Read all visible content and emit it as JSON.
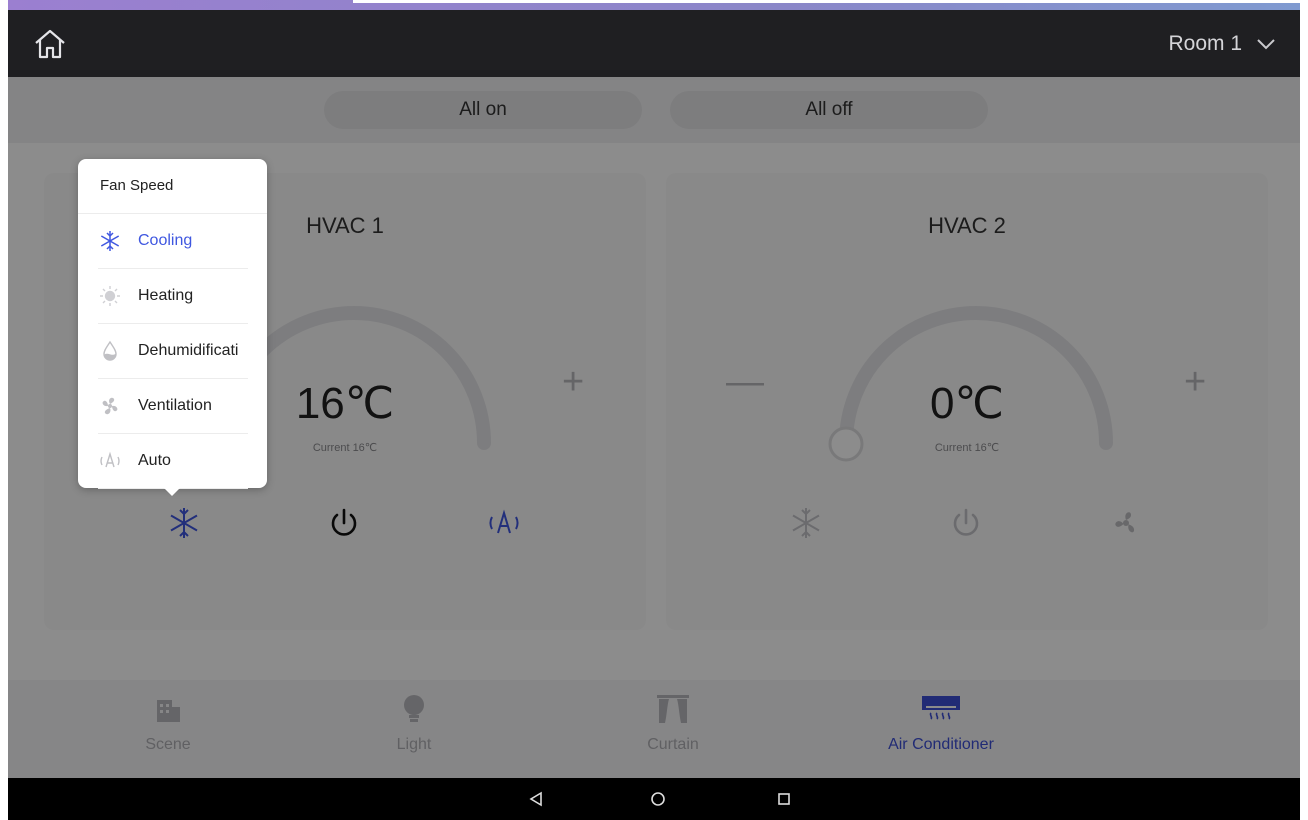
{
  "topbar": {
    "room_label": "Room 1"
  },
  "actions": {
    "all_on": "All on",
    "all_off": "All off"
  },
  "hvac": [
    {
      "name": "HVAC 1",
      "temperature": "16℃",
      "current": "Current 16℃"
    },
    {
      "name": "HVAC 2",
      "temperature": "0℃",
      "current": "Current 16℃"
    }
  ],
  "popup": {
    "title": "Fan Speed",
    "modes": [
      {
        "label": "Cooling",
        "icon": "snowflake-icon",
        "selected": true
      },
      {
        "label": "Heating",
        "icon": "sun-icon"
      },
      {
        "label": "Dehumidification",
        "icon": "droplet-icon"
      },
      {
        "label": "Ventilation",
        "icon": "fan-icon"
      },
      {
        "label": "Auto",
        "icon": "auto-icon"
      }
    ]
  },
  "bottom_nav": [
    {
      "label": "Scene",
      "icon": "building-icon"
    },
    {
      "label": "Light",
      "icon": "bulb-icon"
    },
    {
      "label": "Curtain",
      "icon": "curtain-icon"
    },
    {
      "label": "Air Conditioner",
      "icon": "air-conditioner-icon",
      "active": true
    }
  ],
  "colors": {
    "accent": "#3f57e0",
    "topbar": "#1f1f22",
    "overlay": "rgba(0,0,0,0.45)"
  }
}
